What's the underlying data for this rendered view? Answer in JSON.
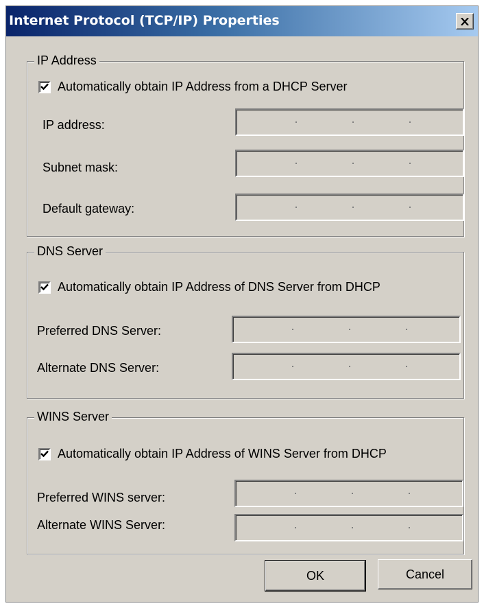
{
  "window": {
    "title": "Internet Protocol (TCP/IP) Properties",
    "close_icon": "close-icon"
  },
  "ip_group": {
    "legend": "IP Address",
    "auto_checkbox": {
      "label": "Automatically obtain IP Address from a DHCP Server",
      "checked": true
    },
    "fields": [
      {
        "label": "IP address:",
        "value": ""
      },
      {
        "label": "Subnet mask:",
        "value": ""
      },
      {
        "label": "Default gateway:",
        "value": ""
      }
    ]
  },
  "dns_group": {
    "legend": "DNS Server",
    "auto_checkbox": {
      "label": "Automatically obtain IP Address of DNS Server from DHCP",
      "checked": true
    },
    "fields": [
      {
        "label": "Preferred DNS Server:",
        "value": ""
      },
      {
        "label": "Alternate DNS Server:",
        "value": ""
      }
    ]
  },
  "wins_group": {
    "legend": "WINS Server",
    "auto_checkbox": {
      "label": "Automatically obtain IP Address of WINS Server from DHCP",
      "checked": true
    },
    "fields": [
      {
        "label": "Preferred WINS server:",
        "value": ""
      },
      {
        "label": "Alternate WINS Server:",
        "value": ""
      }
    ]
  },
  "buttons": {
    "ok": "OK",
    "cancel": "Cancel"
  },
  "colors": {
    "dialog_bg": "#d4d0c8",
    "title_start": "#0a246a",
    "title_end": "#a6caf0"
  }
}
